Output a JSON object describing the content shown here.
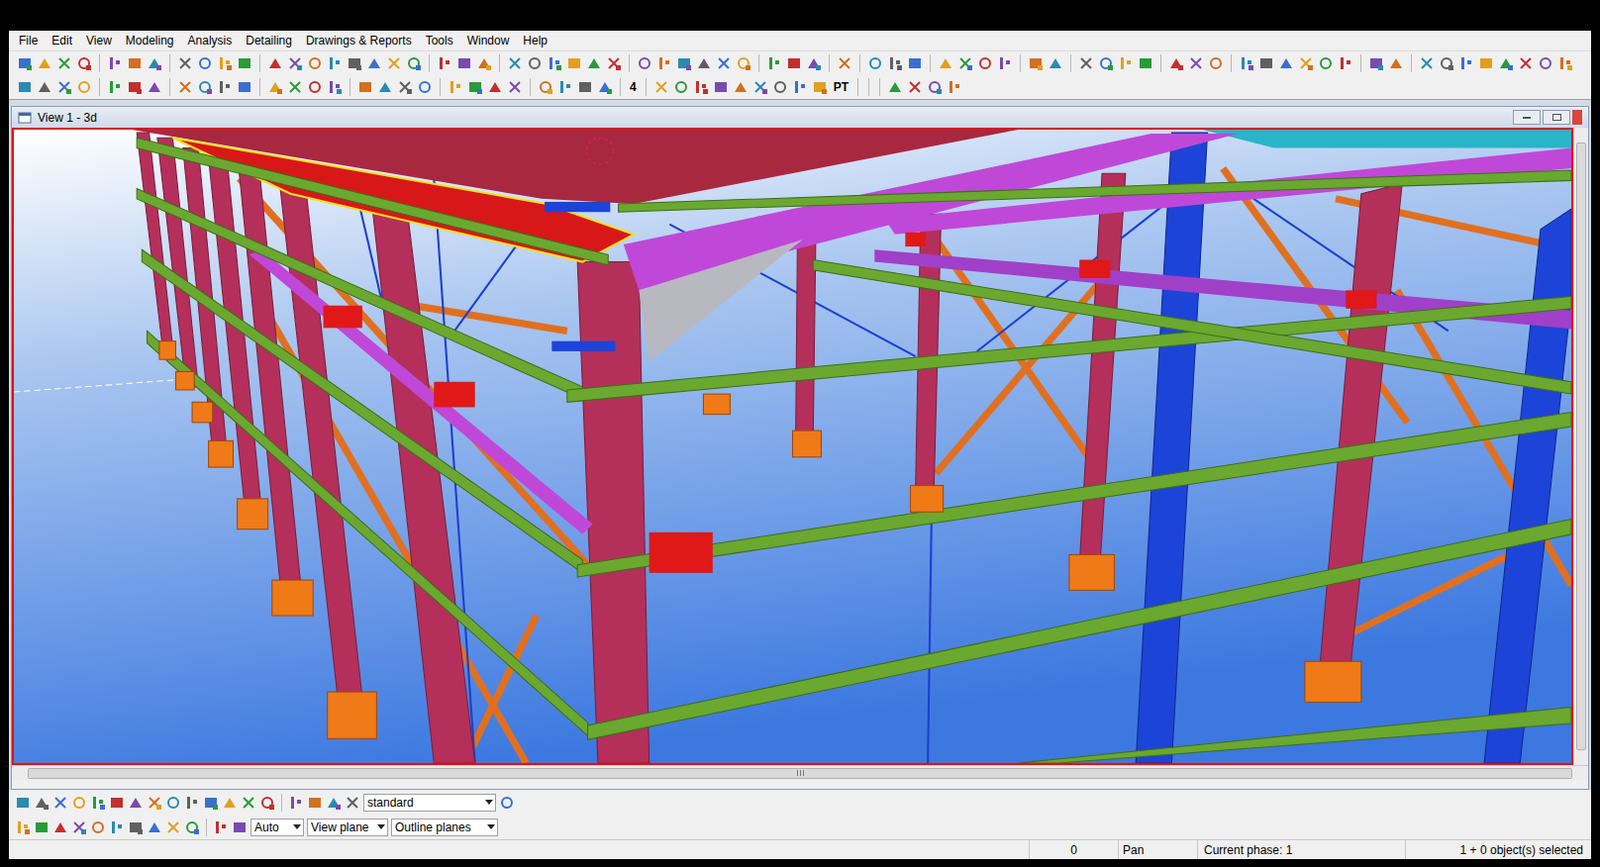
{
  "menu": [
    "File",
    "Edit",
    "View",
    "Modeling",
    "Analysis",
    "Detailing",
    "Drawings & Reports",
    "Tools",
    "Window",
    "Help"
  ],
  "toolbar_labels": [
    "4",
    "PT"
  ],
  "view": {
    "title": "View 1 - 3d",
    "active": true
  },
  "bottom_toolbar": {
    "filter": "standard",
    "snap_mode": "Auto",
    "work_plane": "View plane",
    "plane_display": "Outline planes"
  },
  "status_bar": {
    "count": "0",
    "mode": "Pan",
    "phase": "Current phase: 1",
    "selection": "1 + 0 object(s) selected"
  }
}
